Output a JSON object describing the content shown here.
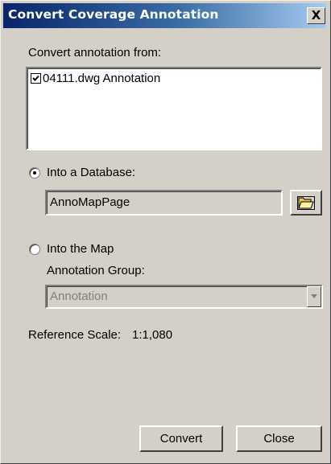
{
  "window": {
    "title": "Convert Coverage Annotation",
    "close_label": "X"
  },
  "source": {
    "label": "Convert annotation from:",
    "items": [
      {
        "label": "04111.dwg Annotation",
        "checked": true
      }
    ]
  },
  "database_option": {
    "label": "Into a Database:",
    "selected": true,
    "value": "AnnoMapPage",
    "browse_icon": "folder-open-icon"
  },
  "map_option": {
    "label": "Into the Map",
    "selected": false,
    "group_label": "Annotation Group:",
    "group_value": "Annotation"
  },
  "reference_scale": {
    "label": "Reference Scale:",
    "value": "1:1,080"
  },
  "buttons": {
    "convert": "Convert",
    "close": "Close"
  }
}
